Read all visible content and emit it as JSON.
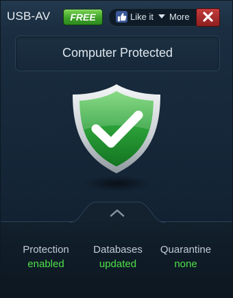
{
  "header": {
    "app_title": "USB-AV",
    "edition_badge": "FREE",
    "like_label": "Like it",
    "more_label": "More",
    "close_icon": "close-icon"
  },
  "status": {
    "message": "Computer Protected",
    "icon": "shield-check-icon",
    "color": "#2fa23b"
  },
  "stats": [
    {
      "label": "Protection",
      "value": "enabled"
    },
    {
      "label": "Databases",
      "value": "updated"
    },
    {
      "label": "Quarantine",
      "value": "none"
    }
  ],
  "colors": {
    "status_ok": "#4fe04a",
    "badge_green": "#3fa12b",
    "close_red": "#b33434"
  }
}
